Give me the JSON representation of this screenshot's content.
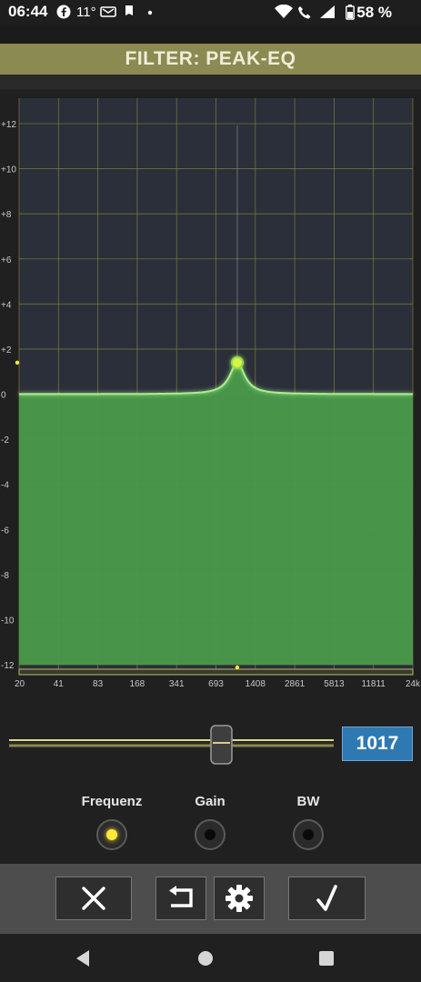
{
  "status_bar": {
    "time": "06:44",
    "temperature": "11°",
    "battery": "58 %"
  },
  "title": "FILTER: PEAK-EQ",
  "chart_data": {
    "type": "area",
    "title": "",
    "y_ticks": [
      "+12",
      "+10",
      "+8",
      "+6",
      "+4",
      "+2",
      "0",
      "-2",
      "-4",
      "-6",
      "-8",
      "-10",
      "-12"
    ],
    "x_ticks": [
      "20",
      "41",
      "83",
      "168",
      "341",
      "693",
      "1408",
      "2861",
      "5813",
      "11811",
      "24k"
    ],
    "ylim": [
      -12,
      12
    ],
    "xlim_hz": [
      20,
      24000
    ],
    "x_scale": "log",
    "grid": true,
    "series": [
      {
        "values": "peak-eq response",
        "center_freq_hz": 1017,
        "gain_db": 1.4,
        "baseline_db": 0
      }
    ],
    "colors": {
      "fill": "#4a9a4a",
      "curve": "#9eea8a",
      "grid": "#8a8a3a",
      "plot_bg": "#2b2f3a",
      "marker": "#ffe93a"
    }
  },
  "slider": {
    "value": "1017"
  },
  "knobs": [
    {
      "label": "Frequenz",
      "active": true
    },
    {
      "label": "Gain",
      "active": false
    },
    {
      "label": "BW",
      "active": false
    }
  ],
  "toolbar": {
    "buttons": [
      "close-icon",
      "undo-icon",
      "gear-icon",
      "check-icon"
    ]
  }
}
